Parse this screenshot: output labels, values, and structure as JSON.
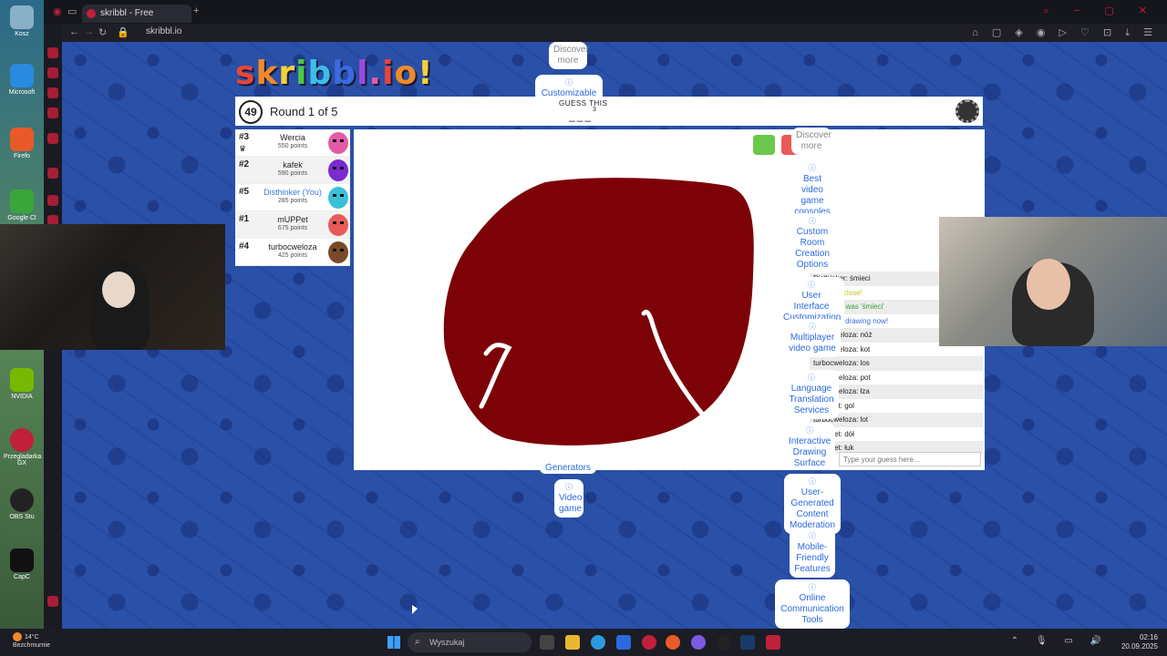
{
  "desktop": {
    "icons": [
      {
        "label": "Kosz"
      },
      {
        "label": "Microsoft"
      },
      {
        "label": "Firefo"
      },
      {
        "label": "Google Cl"
      },
      {
        "label": "NVIDIA"
      },
      {
        "label": "Przegladarka GX"
      },
      {
        "label": "OBS Stu"
      },
      {
        "label": "CapC"
      }
    ]
  },
  "browser": {
    "tab_title": "skribbl - Free Multiplayer",
    "add_tab": "+",
    "url": "skribbl.io",
    "back": "←",
    "forward": "→",
    "reload": "↻",
    "toolbar_icons": "⌂ ▢ ◈ ◉ ▷ ♡ ⊡ ⤓ ☰",
    "window_controls": "⌕ − ▢ ✕"
  },
  "game": {
    "logo": "skribbl.io",
    "timer": "49",
    "round_text": "Round 1 of 5",
    "guess_label": "GUESS THIS",
    "word_hint": "___",
    "word_length": "3",
    "players": [
      {
        "rank": "#3",
        "name": "Wercia",
        "points": "550 points",
        "avatar_color": "#e45aa8",
        "crown": "♛"
      },
      {
        "rank": "#2",
        "name": "kafek",
        "points": "590 points",
        "avatar_color": "#7a2acf"
      },
      {
        "rank": "#5",
        "name": "Disthinker (You)",
        "points": "285 points",
        "avatar_color": "#3ac0d8",
        "you": true
      },
      {
        "rank": "#1",
        "name": "mUPPet",
        "points": "675 points",
        "avatar_color": "#e85a5a"
      },
      {
        "rank": "#4",
        "name": "turbocweloza",
        "points": "425 points",
        "avatar_color": "#7a4a2a"
      }
    ],
    "chat": [
      {
        "text": "Disthinker: śmieci",
        "style": ""
      },
      {
        "text": "śmieci is close!",
        "style": "yellow"
      },
      {
        "text": "The word was 'śmieci'",
        "style": "green"
      },
      {
        "text": "Wercia is drawing now!",
        "style": "blue"
      },
      {
        "text": "turbocweloza: nóż",
        "style": ""
      },
      {
        "text": "turbocweloza: kot",
        "style": ""
      },
      {
        "text": "turbocweloza: los",
        "style": ""
      },
      {
        "text": "turbocweloza: pot",
        "style": ""
      },
      {
        "text": "turbocweloza: łza",
        "style": ""
      },
      {
        "text": "mUPPet: gol",
        "style": ""
      },
      {
        "text": "turbocweloza: lot",
        "style": ""
      },
      {
        "text": "mUPPet: dół",
        "style": ""
      },
      {
        "text": "mUPPet: łuk",
        "style": ""
      }
    ],
    "chat_placeholder": "Type your guess here...",
    "drawing_colors": {
      "fill": "#7d0208",
      "stroke": "#ffffff"
    }
  },
  "ads": {
    "discover_top": "Discover more",
    "customizable": "Customizable",
    "discover_side": "Discover more",
    "chips": [
      "Best video game consoles",
      "Custom Room Creation Options",
      "User Interface Customization",
      "Multiplayer video game",
      "Language Translation Services",
      "Interactive Drawing Surface",
      "User-Generated Content Moderation",
      "Mobile-Friendly Features",
      "Online Communication Tools"
    ],
    "generators": "Generators",
    "video_game": "Video game"
  },
  "taskbar": {
    "weather_temp": "14°C",
    "weather_desc": "Bezchmurnie",
    "search_placeholder": "Wyszukaj",
    "time": "02:16",
    "date": "20.09.2025",
    "tray_icons": "⌃ 🎙 ▭ 🔊"
  }
}
